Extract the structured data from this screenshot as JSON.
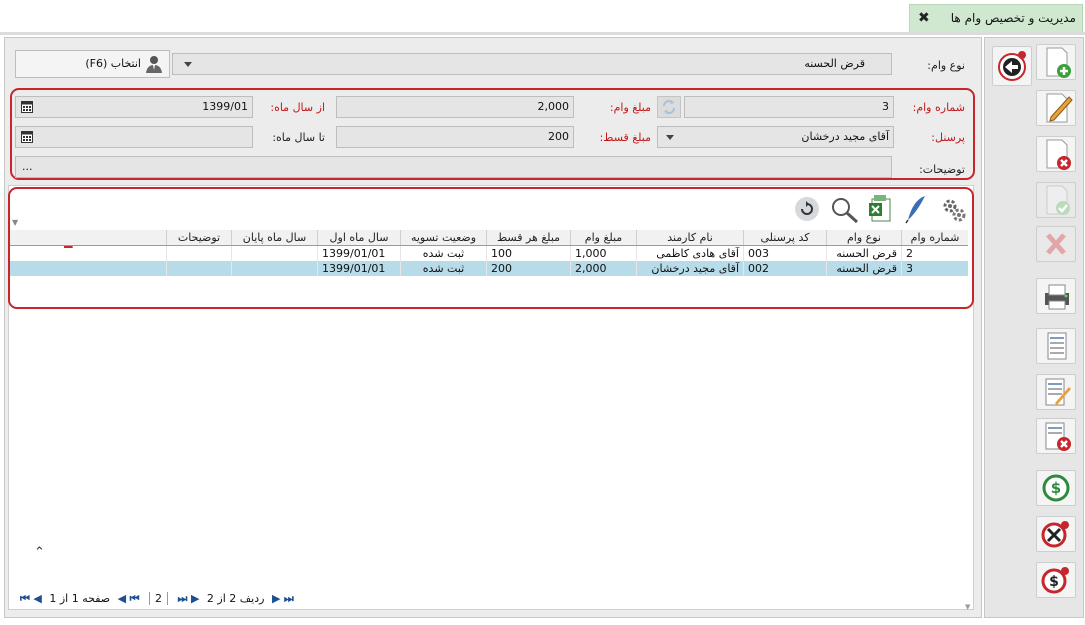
{
  "tab": {
    "title": "مدیریت و تخصیص وام ها"
  },
  "form": {
    "loan_type_label": "نوع وام:",
    "loan_type_value": "قرض الحسنه",
    "select_button_label": "انتخاب (F6)",
    "loan_number_label": "شماره وام:",
    "loan_number_value": "3",
    "loan_amount_label": "مبلغ وام:",
    "loan_amount_value": "2,000",
    "from_month_label": "از سال ماه:",
    "from_month_value": "1399/01",
    "personnel_label": "پرسنل:",
    "personnel_value": "آقای مجید درخشان",
    "installment_label": "مبلغ قسط:",
    "installment_value": "200",
    "to_month_label": "تا سال ماه:",
    "to_month_value": "",
    "description_label": "توضیحات:",
    "description_value": "..."
  },
  "annotations": {
    "form_box_number": "2",
    "grid_box_number": "1"
  },
  "grid": {
    "columns": [
      "شماره وام",
      "نوع وام",
      "کد پرسنلی",
      "نام کارمند",
      "مبلغ وام",
      "مبلغ هر قسط",
      "وضعیت تسویه",
      "سال ماه اول",
      "سال ماه پایان",
      "توضیحات"
    ],
    "rows": [
      [
        "2",
        "قرض الحسنه",
        "003",
        "آقای هادی کاظمی",
        "1,000",
        "100",
        "ثبت شده",
        "1399/01/01",
        "",
        ""
      ],
      [
        "3",
        "قرض الحسنه",
        "002",
        "آقای مجید درخشان",
        "2,000",
        "200",
        "ثبت شده",
        "1399/01/01",
        "",
        ""
      ]
    ],
    "selected_row": 1
  },
  "pager": {
    "page_text": "صفحه 1 از 1",
    "page_size": "2",
    "row_text": "ردیف 2 از 2"
  },
  "grid_toolbar_icons": [
    "settings-icon",
    "feather-edit-icon",
    "excel-export-icon",
    "search-icon",
    "refresh-icon"
  ],
  "side_toolbar_icons": [
    "add-document-icon",
    "edit-document-icon",
    "delete-document-icon",
    "confirm-icon",
    "cancel-icon",
    "print-icon",
    "form-document-icon",
    "form-edit-icon",
    "form-delete-icon",
    "dollar-icon",
    "dollar-cancel-icon",
    "dollar-refund-icon",
    "back-icon"
  ],
  "colors": {
    "accent_red": "#c6262c",
    "selected_row": "#b7dbe9",
    "tab_bg": "#cfe8cf"
  }
}
